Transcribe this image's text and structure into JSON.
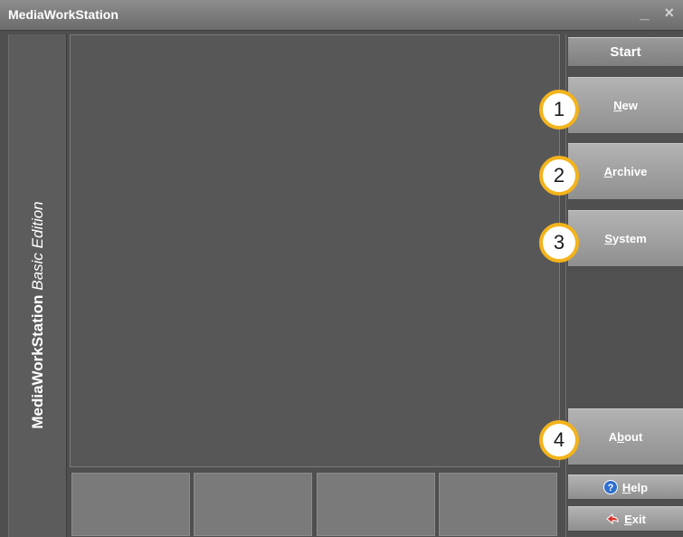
{
  "window": {
    "title": "MediaWorkStation",
    "controls": "_ ×"
  },
  "sidebar": {
    "brand": "MediaWorkStation",
    "edition": "Basic Edition"
  },
  "menu": {
    "start_label": "Start",
    "new": {
      "prefix": "",
      "accel": "N",
      "rest": "ew"
    },
    "archive": {
      "prefix": "",
      "accel": "A",
      "rest": "rchive"
    },
    "system": {
      "prefix": "",
      "accel": "S",
      "rest": "ystem"
    },
    "about": {
      "prefix": "A",
      "accel": "b",
      "rest": "out"
    },
    "help": {
      "prefix": "",
      "accel": "H",
      "rest": "elp"
    },
    "exit": {
      "prefix": "",
      "accel": "E",
      "rest": "xit"
    }
  },
  "callouts": [
    "1",
    "2",
    "3",
    "4"
  ],
  "colors": {
    "callout_ring": "#f3b31b",
    "help_icon": "#2f6fcf",
    "exit_icon": "#d9322a"
  },
  "icons": {
    "help": "question-circle-icon",
    "exit": "exit-arrow-icon"
  }
}
